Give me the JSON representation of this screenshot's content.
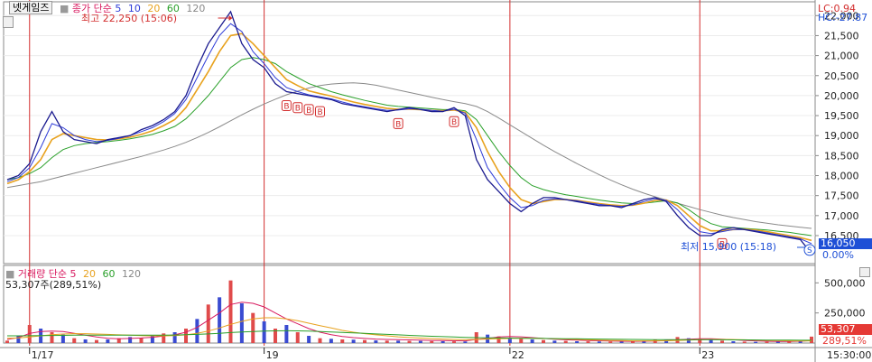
{
  "title": "넷게임즈",
  "price_panel": {
    "legend": {
      "label": "종가",
      "method": "단순",
      "periods": [
        "5",
        "10",
        "20",
        "60",
        "120"
      ]
    },
    "high_annotation": "최고 22,250 (15:06)",
    "low_annotation": "최저 15,900 (15:18)",
    "lc_text": "LC:0.94",
    "hc_text": "HC:-27.87",
    "current_value": "16,050",
    "current_pct": "0.00%",
    "signal_label": "B",
    "sell_label": "S"
  },
  "volume_panel": {
    "legend": {
      "label": "거래량",
      "method": "단순",
      "periods": [
        "5",
        "20",
        "60",
        "120"
      ]
    },
    "summary": "53,307주(289,51%)",
    "current_value": "53,307",
    "current_pct": "289,51%"
  },
  "x_axis": {
    "labels": [
      "1/17",
      "19",
      "22",
      "23"
    ],
    "time_label": "15:30:00"
  },
  "colors": {
    "price_line": "#1b1b8f",
    "ma5": "#2e3cd8",
    "ma10": "#e8a21e",
    "ma20": "#2aa02a",
    "ma60": "#8a8a8a",
    "divider": "#d32f2f",
    "signal": "#d32f2f",
    "current_box": "#1e4fd6",
    "volume_box": "#e53935"
  },
  "chart_data": [
    {
      "type": "line",
      "title": "",
      "y_ticks": [
        16500,
        17000,
        17500,
        18000,
        18500,
        19000,
        19500,
        20000,
        20500,
        21000,
        21500,
        22000
      ],
      "y_tick_labels": [
        "16,500",
        "17,000",
        "17,500",
        "18,000",
        "18,500",
        "19,000",
        "19,500",
        "20,000",
        "20,500",
        "21,000",
        "21,500",
        "22,000"
      ],
      "ylim": [
        15800,
        22300
      ],
      "day_labels": [
        "1/17",
        "19",
        "22",
        "23"
      ],
      "series": [
        {
          "name": "종가",
          "values": [
            17900,
            18000,
            18300,
            19100,
            19600,
            19100,
            18900,
            18850,
            18800,
            18900,
            18950,
            19000,
            19150,
            19250,
            19400,
            19600,
            20000,
            20700,
            21300,
            21700,
            22100,
            21300,
            20900,
            20700,
            20300,
            20100,
            20050,
            20000,
            19950,
            19900,
            19800,
            19750,
            19700,
            19650,
            19600,
            19650,
            19700,
            19650,
            19600,
            19600,
            19700,
            19500,
            18400,
            17900,
            17600,
            17300,
            17100,
            17300,
            17450,
            17450,
            17400,
            17350,
            17300,
            17250,
            17250,
            17200,
            17300,
            17400,
            17450,
            17350,
            17000,
            16700,
            16500,
            16500,
            16650,
            16700,
            16650,
            16600,
            16550,
            16500,
            16450,
            16400,
            16050
          ]
        },
        {
          "name": "5",
          "values": [
            17850,
            17950,
            18200,
            18700,
            19300,
            19200,
            19000,
            18900,
            18850,
            18880,
            18930,
            19000,
            19100,
            19200,
            19350,
            19550,
            19900,
            20450,
            21000,
            21500,
            21800,
            21600,
            21100,
            20800,
            20450,
            20200,
            20100,
            20020,
            19970,
            19920,
            19840,
            19770,
            19720,
            19670,
            19630,
            19640,
            19670,
            19660,
            19630,
            19610,
            19660,
            19560,
            18900,
            18200,
            17800,
            17450,
            17200,
            17250,
            17380,
            17420,
            17400,
            17370,
            17320,
            17280,
            17250,
            17230,
            17270,
            17350,
            17420,
            17380,
            17150,
            16850,
            16600,
            16550,
            16600,
            16650,
            16650,
            16620,
            16570,
            16520,
            16470,
            16420,
            16300
          ]
        },
        {
          "name": "10",
          "values": [
            17800,
            17900,
            18100,
            18400,
            18900,
            19050,
            19000,
            18950,
            18900,
            18890,
            18920,
            18960,
            19030,
            19120,
            19250,
            19400,
            19700,
            20150,
            20600,
            21100,
            21500,
            21550,
            21300,
            21000,
            20700,
            20400,
            20250,
            20120,
            20050,
            19990,
            19910,
            19840,
            19780,
            19730,
            19680,
            19660,
            19660,
            19650,
            19630,
            19620,
            19640,
            19580,
            19200,
            18600,
            18100,
            17700,
            17400,
            17300,
            17350,
            17400,
            17400,
            17380,
            17340,
            17300,
            17270,
            17250,
            17260,
            17310,
            17380,
            17390,
            17250,
            17000,
            16750,
            16620,
            16620,
            16650,
            16660,
            16640,
            16600,
            16550,
            16500,
            16450,
            16380
          ]
        },
        {
          "name": "20",
          "values": [
            17900,
            17950,
            18050,
            18200,
            18450,
            18650,
            18750,
            18800,
            18830,
            18850,
            18880,
            18920,
            18970,
            19030,
            19120,
            19230,
            19420,
            19700,
            20000,
            20350,
            20700,
            20900,
            20950,
            20900,
            20800,
            20600,
            20450,
            20300,
            20200,
            20100,
            20020,
            19950,
            19880,
            19820,
            19760,
            19730,
            19710,
            19690,
            19670,
            19650,
            19650,
            19620,
            19400,
            19000,
            18600,
            18250,
            17950,
            17750,
            17650,
            17580,
            17520,
            17480,
            17430,
            17390,
            17350,
            17320,
            17300,
            17310,
            17340,
            17370,
            17320,
            17150,
            16950,
            16800,
            16720,
            16700,
            16680,
            16660,
            16640,
            16610,
            16580,
            16540,
            16500
          ]
        },
        {
          "name": "60",
          "values": [
            17700,
            17750,
            17800,
            17850,
            17920,
            17990,
            18060,
            18130,
            18200,
            18270,
            18340,
            18410,
            18480,
            18560,
            18640,
            18730,
            18830,
            18950,
            19080,
            19220,
            19370,
            19520,
            19660,
            19790,
            19910,
            20020,
            20110,
            20190,
            20250,
            20290,
            20310,
            20320,
            20300,
            20260,
            20200,
            20140,
            20080,
            20020,
            19960,
            19900,
            19850,
            19800,
            19730,
            19600,
            19440,
            19270,
            19100,
            18930,
            18760,
            18600,
            18450,
            18300,
            18160,
            18020,
            17890,
            17770,
            17660,
            17560,
            17470,
            17390,
            17310,
            17230,
            17150,
            17080,
            17010,
            16950,
            16900,
            16850,
            16810,
            16770,
            16740,
            16710,
            16680
          ]
        }
      ]
    },
    {
      "type": "bar",
      "title": "",
      "y_ticks": [
        250000,
        500000
      ],
      "y_tick_labels": [
        "250,000",
        "500,000"
      ],
      "ylim": [
        0,
        600000
      ],
      "series": [
        {
          "name": "거래량",
          "values": [
            20000,
            60000,
            150000,
            120000,
            90000,
            70000,
            40000,
            30000,
            25000,
            30000,
            40000,
            50000,
            45000,
            60000,
            80000,
            90000,
            120000,
            200000,
            320000,
            380000,
            520000,
            330000,
            250000,
            180000,
            120000,
            150000,
            90000,
            60000,
            40000,
            35000,
            30000,
            28000,
            25000,
            22000,
            20000,
            20000,
            18000,
            18000,
            16000,
            15000,
            14000,
            13000,
            90000,
            70000,
            55000,
            45000,
            35000,
            30000,
            25000,
            20000,
            18000,
            15000,
            14000,
            13000,
            12000,
            11000,
            12000,
            20000,
            30000,
            25000,
            50000,
            40000,
            35000,
            25000,
            20000,
            15000,
            12000,
            10000,
            10000,
            12000,
            15000,
            20000,
            53307
          ]
        },
        {
          "name": "5",
          "values": [
            30000,
            45000,
            80000,
            95000,
            100000,
            95000,
            80000,
            65000,
            50000,
            40000,
            35000,
            38000,
            42000,
            48000,
            58000,
            68000,
            90000,
            130000,
            190000,
            250000,
            320000,
            340000,
            330000,
            300000,
            250000,
            200000,
            160000,
            120000,
            90000,
            70000,
            55000,
            45000,
            38000,
            33000,
            30000,
            28000,
            26000,
            24000,
            22000,
            20000,
            19000,
            18000,
            30000,
            40000,
            50000,
            55000,
            52000,
            45000,
            38000,
            32000,
            27000,
            24000,
            21000,
            19000,
            17000,
            15000,
            14000,
            15000,
            17000,
            20000,
            27000,
            32000,
            35000,
            35000,
            32000,
            27000,
            22000,
            18000,
            15000,
            13000,
            13000,
            15000,
            20000
          ]
        },
        {
          "name": "20",
          "values": [
            40000,
            42000,
            50000,
            60000,
            70000,
            75000,
            78000,
            78000,
            75000,
            72000,
            68000,
            65000,
            62000,
            60000,
            60000,
            62000,
            68000,
            80000,
            100000,
            125000,
            155000,
            180000,
            200000,
            210000,
            210000,
            200000,
            185000,
            165000,
            145000,
            125000,
            105000,
            90000,
            78000,
            68000,
            60000,
            52000,
            46000,
            41000,
            37000,
            33000,
            30000,
            28000,
            30000,
            33000,
            36000,
            38000,
            39000,
            39000,
            38000,
            36000,
            33000,
            30000,
            27000,
            24000,
            22000,
            20000,
            18000,
            18000,
            18000,
            19000,
            22000,
            25000,
            28000,
            30000,
            30000,
            29000,
            27000,
            25000,
            22000,
            20000,
            18000,
            17000,
            18000
          ]
        },
        {
          "name": "60",
          "values": [
            60000,
            60000,
            61000,
            62000,
            63000,
            64000,
            65000,
            65000,
            65000,
            65000,
            65000,
            65000,
            65000,
            65000,
            66000,
            67000,
            69000,
            72000,
            76000,
            81000,
            87000,
            92000,
            96000,
            99000,
            101000,
            102000,
            101000,
            99000,
            96000,
            92000,
            88000,
            84000,
            80000,
            76000,
            72000,
            68000,
            64000,
            60000,
            56000,
            53000,
            50000,
            47000,
            45000,
            43000,
            42000,
            41000,
            40000,
            39000,
            38000,
            37000,
            36000,
            35000,
            34000,
            33000,
            32000,
            31000,
            30000,
            29000,
            28500,
            28000,
            28000,
            28000,
            28000,
            27500,
            27000,
            26500,
            26000,
            25500,
            25000,
            24500,
            24000,
            23500,
            23000
          ]
        }
      ]
    }
  ]
}
